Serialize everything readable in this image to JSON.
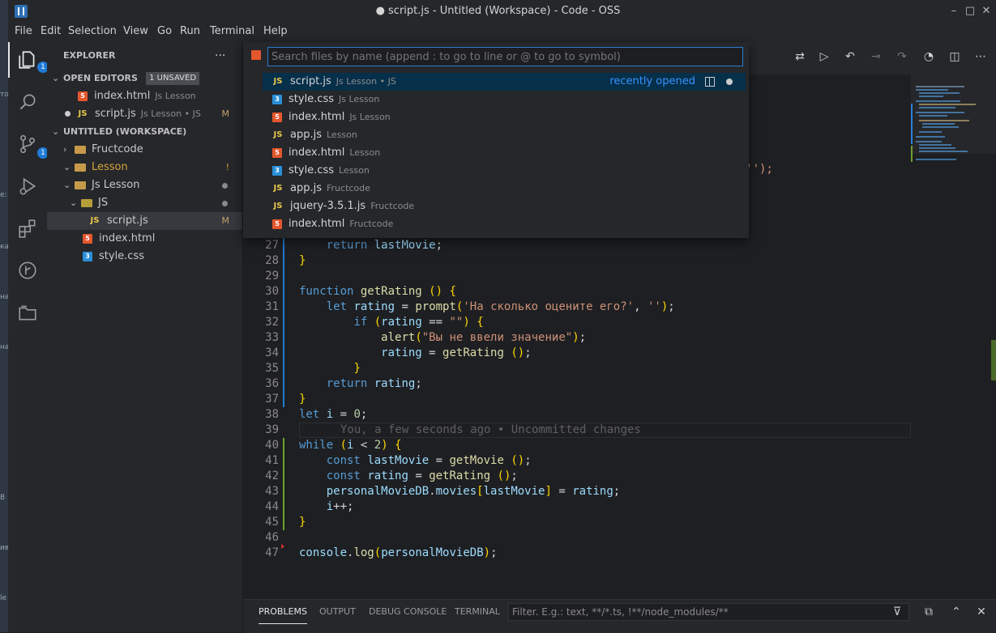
{
  "window": {
    "title": "● script.js - Untitled (Workspace) - Code - OSS"
  },
  "menu": [
    "File",
    "Edit",
    "Selection",
    "View",
    "Go",
    "Run",
    "Terminal",
    "Help"
  ],
  "host_strip": [
    "то",
    "е:",
    "ка",
    "на",
    "на",
    "В",
    "ив",
    "le"
  ],
  "activity": {
    "explorer_badge": "1",
    "scm_badge": "1"
  },
  "sidebar": {
    "title": "EXPLORER",
    "more": "···",
    "open_editors": {
      "label": "OPEN EDITORS",
      "badge": "1 UNSAVED"
    },
    "open_files": [
      {
        "name": "index.html",
        "desc": "Js Lesson",
        "type": "html"
      },
      {
        "name": "script.js",
        "desc": "Js Lesson • JS",
        "type": "js",
        "mark": "M"
      }
    ],
    "workspace": {
      "label": "UNTITLED (WORKSPACE)"
    },
    "tree": [
      {
        "name": "Fructcode",
        "chev": "›",
        "mark": ""
      },
      {
        "name": "Lesson",
        "chev": "⌄",
        "mark": "!"
      },
      {
        "name": "Js Lesson",
        "chev": "⌄",
        "mark": ""
      },
      {
        "name": "JS",
        "chev": "⌄",
        "mark": ""
      },
      {
        "name": "script.js",
        "mark": "M"
      },
      {
        "name": "index.html",
        "mark": ""
      },
      {
        "name": "style.css",
        "mark": ""
      }
    ]
  },
  "quickopen": {
    "placeholder": "Search files by name (append : to go to line or @ to go to symbol)",
    "recently_label": "recently opened",
    "items": [
      {
        "type": "js",
        "name": "script.js",
        "desc": "Js Lesson • JS"
      },
      {
        "type": "css",
        "name": "style.css",
        "desc": "Js Lesson"
      },
      {
        "type": "html",
        "name": "index.html",
        "desc": "Js Lesson"
      },
      {
        "type": "js",
        "name": "app.js",
        "desc": "Lesson"
      },
      {
        "type": "html",
        "name": "index.html",
        "desc": "Lesson"
      },
      {
        "type": "css",
        "name": "style.css",
        "desc": "Lesson"
      },
      {
        "type": "js",
        "name": "app.js",
        "desc": "Fructcode"
      },
      {
        "type": "js",
        "name": "jquery-3.5.1.js",
        "desc": "Fructcode"
      },
      {
        "type": "html",
        "name": "index.html",
        "desc": "Fructcode"
      }
    ]
  },
  "editor": {
    "partial_line_tail": "в?', '');",
    "blame": "You, a few seconds ago • Uncommitted changes",
    "lines": [
      {
        "n": "27",
        "code": "    return lastMovie;"
      },
      {
        "n": "28",
        "code": "}"
      },
      {
        "n": "29",
        "code": ""
      },
      {
        "n": "30",
        "code": "function getRating () {"
      },
      {
        "n": "31",
        "code": "    let rating = prompt('На сколько оцените его?', '');"
      },
      {
        "n": "32",
        "code": "        if (rating == \"\") {"
      },
      {
        "n": "33",
        "code": "            alert(\"Вы не ввели значение\");"
      },
      {
        "n": "34",
        "code": "            rating = getRating ();"
      },
      {
        "n": "35",
        "code": "        }"
      },
      {
        "n": "36",
        "code": "    return rating;"
      },
      {
        "n": "37",
        "code": "}"
      },
      {
        "n": "38",
        "code": "let i = 0;"
      },
      {
        "n": "39",
        "code": ""
      },
      {
        "n": "40",
        "code": "while (i < 2) {"
      },
      {
        "n": "41",
        "code": "    const lastMovie = getMovie ();"
      },
      {
        "n": "42",
        "code": "    const rating = getRating ();"
      },
      {
        "n": "43",
        "code": "    personalMovieDB.movies[lastMovie] = rating;"
      },
      {
        "n": "44",
        "code": "    i++;"
      },
      {
        "n": "45",
        "code": "}"
      },
      {
        "n": "46",
        "code": ""
      },
      {
        "n": "47",
        "code": "console.log(personalMovieDB);"
      }
    ]
  },
  "panel": {
    "tabs": [
      "PROBLEMS",
      "OUTPUT",
      "DEBUG CONSOLE",
      "TERMINAL"
    ],
    "filter_placeholder": "Filter. E.g.: text, **/*.ts, !**/node_modules/**"
  }
}
